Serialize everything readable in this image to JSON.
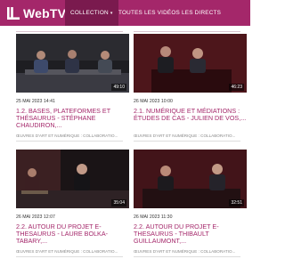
{
  "brand": {
    "name": "WebTV"
  },
  "nav": {
    "collection": "COLLECTION",
    "all_videos": "TOUTES LES VIDÉOS",
    "live": "LES DIRECTS"
  },
  "videos": [
    {
      "date": "25 MAI 2023 14:41",
      "duration": "49:10",
      "title": "1.2. BASES, PLATEFORMES ET THÉSAURUS - Stéphane CHAUDIRON,...",
      "tags": "ŒUVRES D'ART ET NUMÉRIQUE : COLLABORATIO..."
    },
    {
      "date": "26 MAI 2023 10:00",
      "duration": "46:23",
      "title": "2.1. NUMÉRIQUE ET MÉDIATIONS : ÉTUDES DE CAS - Julien DE VOS,...",
      "tags": "ŒUVRES D'ART ET NUMÉRIQUE : COLLABORATIO..."
    },
    {
      "date": "26 MAI 2023 12:07",
      "duration": "35:04",
      "title": "2.2. AUTOUR DU PROJET E-THESAURUS - Laure BOLKA-TABARY,...",
      "tags": "ŒUVRES D'ART ET NUMÉRIQUE : COLLABORATIO..."
    },
    {
      "date": "26 MAI 2023 11:30",
      "duration": "32:51",
      "title": "2.2. AUTOUR DU PROJET E-THESAURUS - Thibault GUILLAUMONT,...",
      "tags": "ŒUVRES D'ART ET NUMÉRIQUE : COLLABORATIO..."
    }
  ]
}
